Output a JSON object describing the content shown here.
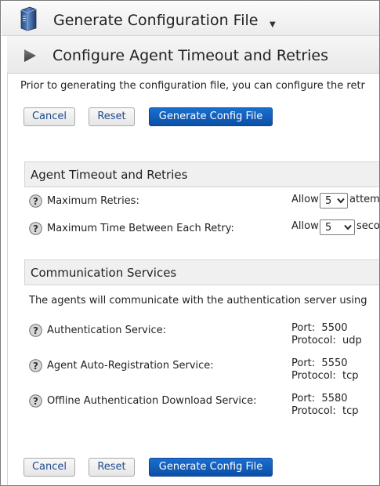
{
  "header": {
    "title": "Generate Configuration File",
    "menu_caret": "▼"
  },
  "subheader": {
    "title": "Configure Agent Timeout and Retries"
  },
  "intro_text": "Prior to generating the configuration file, you can configure the retr",
  "buttons": {
    "cancel": "Cancel",
    "reset": "Reset",
    "generate": "Generate Config File"
  },
  "timeout_section": {
    "title": "Agent Timeout and Retries",
    "rows": [
      {
        "label": "Maximum Retries:",
        "prefix": "Allow",
        "value": "5",
        "suffix": "attem"
      },
      {
        "label": "Maximum Time Between Each Retry:",
        "prefix": "Allow",
        "value": "5",
        "suffix": "seco"
      }
    ]
  },
  "comm_section": {
    "title": "Communication Services",
    "description": "The agents will communicate with the authentication server using",
    "services": [
      {
        "label": "Authentication Service:",
        "port_label": "Port:",
        "port": "5500",
        "protocol_label": "Protocol:",
        "protocol": "udp"
      },
      {
        "label": "Agent Auto-Registration Service:",
        "port_label": "Port:",
        "port": "5550",
        "protocol_label": "Protocol:",
        "protocol": "tcp"
      },
      {
        "label": "Offline Authentication Download Service:",
        "port_label": "Port:",
        "port": "5580",
        "protocol_label": "Protocol:",
        "protocol": "tcp"
      }
    ]
  },
  "icons": {
    "server": "server-icon",
    "play": "play-arrow-icon",
    "help": "help-icon"
  },
  "colors": {
    "primary_button": "#0b5bbf",
    "link_text": "#1d4a8c",
    "section_bg": "#f0f0f0"
  }
}
